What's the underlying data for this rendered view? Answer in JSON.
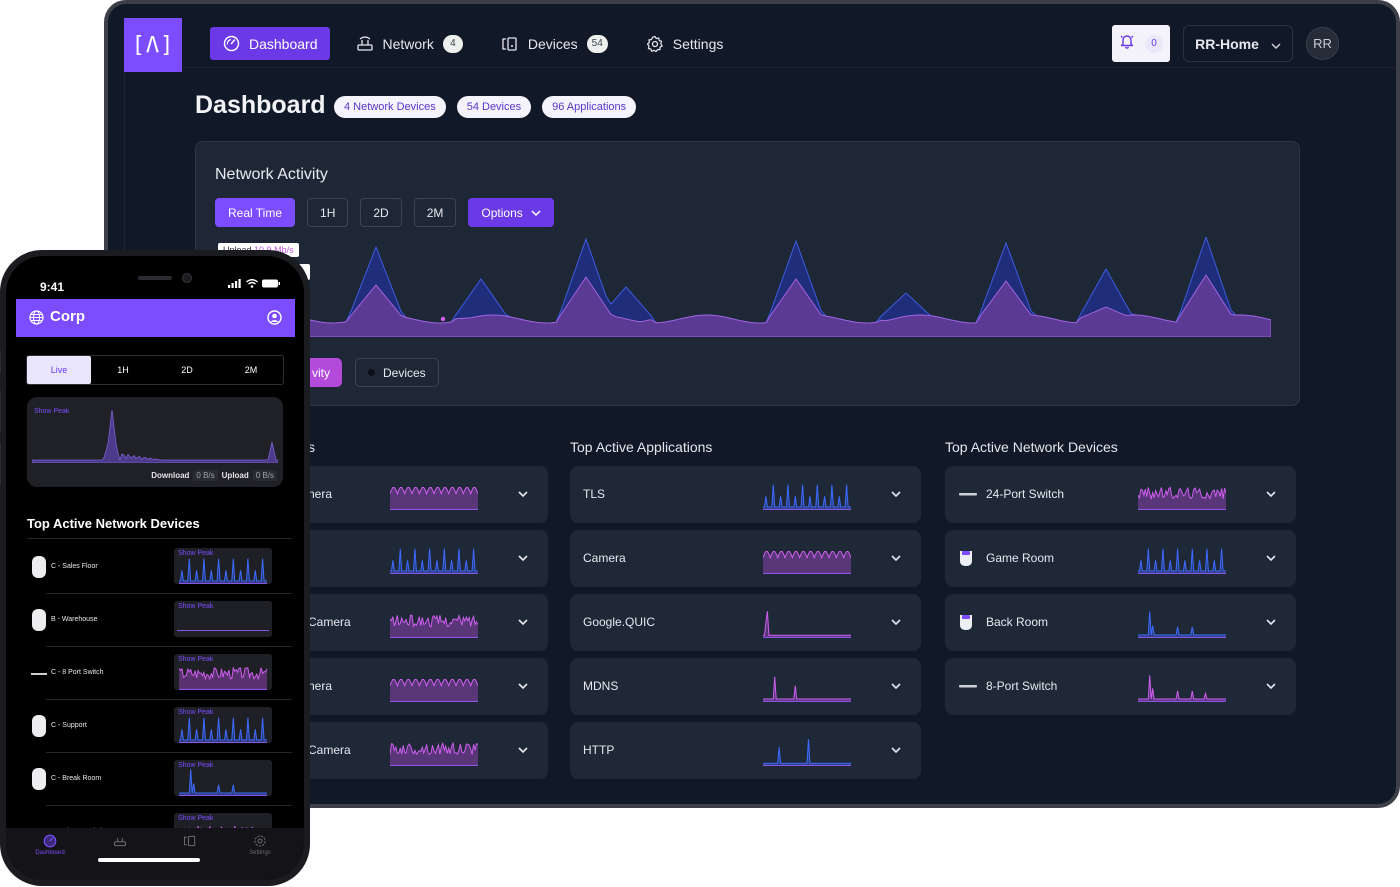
{
  "app": {
    "logo": "[Λ]",
    "nav": [
      {
        "label": "Dashboard",
        "icon": "gauge-icon",
        "active": true
      },
      {
        "label": "Network",
        "icon": "router-icon",
        "badge": "4"
      },
      {
        "label": "Devices",
        "icon": "devices-icon",
        "badge": "54"
      },
      {
        "label": "Settings",
        "icon": "gear-icon"
      }
    ],
    "notifications": {
      "count": "0"
    },
    "site_selector": {
      "value": "RR-Home"
    },
    "avatar": "RR"
  },
  "dashboard": {
    "title": "Dashboard",
    "chips": [
      "4 Network Devices",
      "54 Devices",
      "96 Applications"
    ],
    "network_activity": {
      "title": "Network Activity",
      "ranges": [
        "Real Time",
        "1H",
        "2D",
        "2M"
      ],
      "active_range": "Real Time",
      "options_label": "Options",
      "tooltip_upload_label": "Upload",
      "tooltip_upload_value": "10.9 Mb/s",
      "legend": [
        "Activity",
        "Devices"
      ],
      "legend_visible_activity": "vity"
    },
    "top_clients": {
      "title_fragment": "s",
      "rows": [
        {
          "label": "nera",
          "spark": "magenta-wave"
        },
        {
          "label": "",
          "spark": "blue-peaks"
        },
        {
          "label": "Camera",
          "spark": "magenta-noise"
        },
        {
          "label": "nera",
          "spark": "magenta-wave"
        },
        {
          "label": "Camera",
          "spark": "magenta-noise"
        }
      ]
    },
    "top_applications": {
      "title": "Top Active Applications",
      "rows": [
        {
          "label": "TLS",
          "spark": "blue-peaks"
        },
        {
          "label": "Camera",
          "spark": "magenta-wave"
        },
        {
          "label": "Google.QUIC",
          "spark": "single-spike"
        },
        {
          "label": "MDNS",
          "spark": "two-spikes"
        },
        {
          "label": "HTTP",
          "spark": "two-blue-spikes"
        }
      ]
    },
    "top_network_devices": {
      "title": "Top Active Network Devices",
      "rows": [
        {
          "label": "24-Port Switch",
          "icon": "switch-icon",
          "spark": "magenta-noise"
        },
        {
          "label": "Game Room",
          "icon": "access-point-icon",
          "spark": "blue-peaks"
        },
        {
          "label": "Back Room",
          "icon": "access-point-icon",
          "spark": "blue-spikes"
        },
        {
          "label": "8-Port Switch",
          "icon": "switch-icon",
          "spark": "magenta-spikes"
        }
      ]
    }
  },
  "phone": {
    "time": "9:41",
    "site": "Corp",
    "ranges": [
      "Live",
      "1H",
      "2D",
      "2M"
    ],
    "active_range": "Live",
    "show_peak": "Show Peak",
    "download_label": "Download",
    "download_value": "0 B/s",
    "upload_label": "Upload",
    "upload_value": "0 B/s",
    "section_title": "Top Active Network Devices",
    "devices": [
      {
        "label": "C - Sales Floor",
        "icon": "access-point-icon"
      },
      {
        "label": "B - Warehouse",
        "icon": "access-point-icon"
      },
      {
        "label": "C - 8 Port Switch",
        "icon": "switch-icon"
      },
      {
        "label": "C - Support",
        "icon": "access-point-icon"
      },
      {
        "label": "C - Break Room",
        "icon": "access-point-icon"
      },
      {
        "label": "B - Closet Switch",
        "icon": "switch-icon"
      }
    ],
    "tabs": [
      "Dashboard",
      "Network",
      "Devices",
      "Settings"
    ]
  },
  "colors": {
    "accent": "#7c4dff",
    "accent_dark": "#6b3ae6",
    "magenta": "#c05ae0",
    "blue": "#3b5bdb",
    "bg": "#111827",
    "card": "#1e2837"
  }
}
